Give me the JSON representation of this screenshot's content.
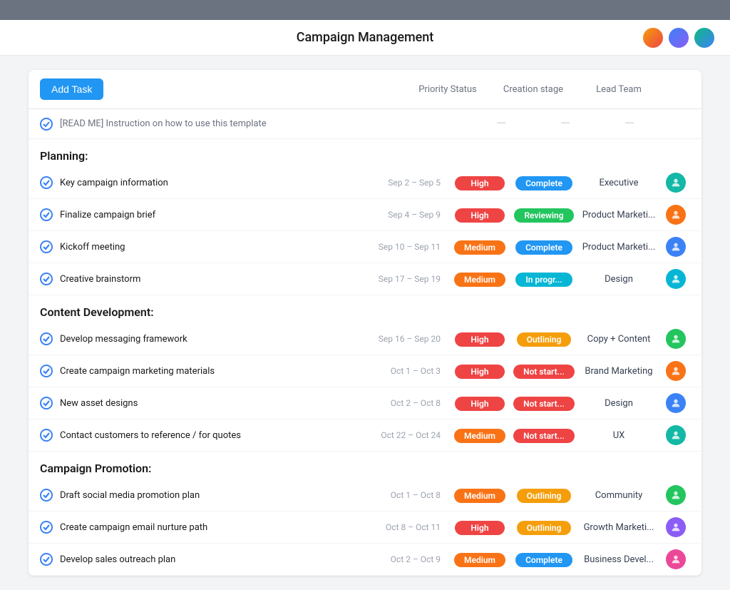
{
  "header": {
    "title": "Campaign Management"
  },
  "toolbar": {
    "add_task_label": "Add Task",
    "col_priority": "Priority Status",
    "col_creation": "Creation stage",
    "col_lead": "Lead Team"
  },
  "readme": {
    "text": "[READ ME] Instruction on how to use this template"
  },
  "sections": [
    {
      "name": "Planning:",
      "tasks": [
        {
          "name": "Key campaign information",
          "date": "Sep 2 – Sep 5",
          "priority": "High",
          "priority_class": "badge-high",
          "status": "Complete",
          "status_class": "badge-complete",
          "lead": "Executive",
          "av_class": "av-teal"
        },
        {
          "name": "Finalize campaign brief",
          "date": "Sep 4 – Sep 9",
          "priority": "High",
          "priority_class": "badge-high",
          "status": "Reviewing",
          "status_class": "badge-reviewing",
          "lead": "Product Marketi...",
          "av_class": "av-orange"
        },
        {
          "name": "Kickoff meeting",
          "date": "Sep 10 – Sep 11",
          "priority": "Medium",
          "priority_class": "badge-medium",
          "status": "Complete",
          "status_class": "badge-complete",
          "lead": "Product Marketi...",
          "av_class": "av-blue"
        },
        {
          "name": "Creative brainstorm",
          "date": "Sep 17 – Sep 19",
          "priority": "Medium",
          "priority_class": "badge-medium",
          "status": "In progr...",
          "status_class": "badge-inprogress",
          "lead": "Design",
          "av_class": "av-cyan"
        }
      ]
    },
    {
      "name": "Content Development:",
      "tasks": [
        {
          "name": "Develop messaging framework",
          "date": "Sep 16 – Sep 20",
          "priority": "High",
          "priority_class": "badge-high",
          "status": "Outlining",
          "status_class": "badge-outlining",
          "lead": "Copy + Content",
          "av_class": "av-green"
        },
        {
          "name": "Create campaign marketing materials",
          "date": "Oct 1 – Oct 3",
          "priority": "High",
          "priority_class": "badge-high",
          "status": "Not start...",
          "status_class": "badge-notstart",
          "lead": "Brand Marketing",
          "av_class": "av-orange"
        },
        {
          "name": "New asset designs",
          "date": "Oct 2 – Oct 8",
          "priority": "High",
          "priority_class": "badge-high",
          "status": "Not start...",
          "status_class": "badge-notstart",
          "lead": "Design",
          "av_class": "av-blue"
        },
        {
          "name": "Contact customers to reference / for quotes",
          "date": "Oct 22 – Oct 24",
          "priority": "Medium",
          "priority_class": "badge-medium",
          "status": "Not start...",
          "status_class": "badge-notstart",
          "lead": "UX",
          "av_class": "av-teal"
        }
      ]
    },
    {
      "name": "Campaign Promotion:",
      "tasks": [
        {
          "name": "Draft social media promotion plan",
          "date": "Oct 1 – Oct 8",
          "priority": "Medium",
          "priority_class": "badge-medium",
          "status": "Outlining",
          "status_class": "badge-outlining",
          "lead": "Community",
          "av_class": "av-green"
        },
        {
          "name": "Create campaign email nurture path",
          "date": "Oct 8 – Oct 11",
          "priority": "High",
          "priority_class": "badge-high",
          "status": "Outlining",
          "status_class": "badge-outlining",
          "lead": "Growth Marketi...",
          "av_class": "av-purple"
        },
        {
          "name": "Develop sales outreach plan",
          "date": "Oct 2 – Oct 9",
          "priority": "Medium",
          "priority_class": "badge-medium",
          "status": "Complete",
          "status_class": "badge-complete",
          "lead": "Business Devel...",
          "av_class": "av-pink"
        }
      ]
    }
  ]
}
